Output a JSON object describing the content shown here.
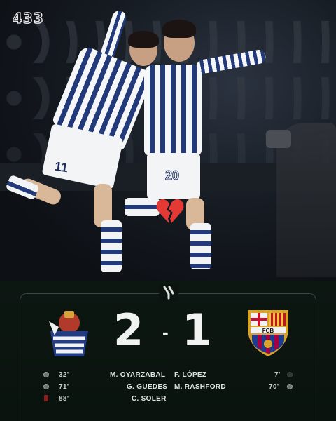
{
  "brand": {
    "logo_text": "433"
  },
  "photo": {
    "players": [
      {
        "number": "11"
      },
      {
        "number": "20"
      }
    ],
    "overlay_icon": "broken-heart-icon"
  },
  "scoreboard": {
    "league_icon": "laliga-logo-icon",
    "home_team_crest": "real-sociedad-crest",
    "away_team_crest": "fc-barcelona-crest",
    "away_crest_text": "FCB",
    "home_score": "2",
    "separator": "-",
    "away_score": "1",
    "home_events": [
      {
        "minute": "32'",
        "player": "M. OYARZABAL",
        "icon": "ball-icon"
      },
      {
        "minute": "71'",
        "player": "G. GUEDES",
        "icon": "ball-icon"
      },
      {
        "minute": "88'",
        "player": "C. SOLER",
        "icon": "red-card-icon"
      }
    ],
    "away_events": [
      {
        "minute": "7'",
        "player": "F. LÓPEZ",
        "icon": "ball-icon"
      },
      {
        "minute": "70'",
        "player": "M. RASHFORD",
        "icon": "ball-icon"
      }
    ]
  },
  "colors": {
    "background": "#0b1410",
    "home_blue": "#233a7a",
    "barca_blue": "#1d3c8f",
    "barca_red": "#a50044",
    "heart_red": "#e53935"
  }
}
